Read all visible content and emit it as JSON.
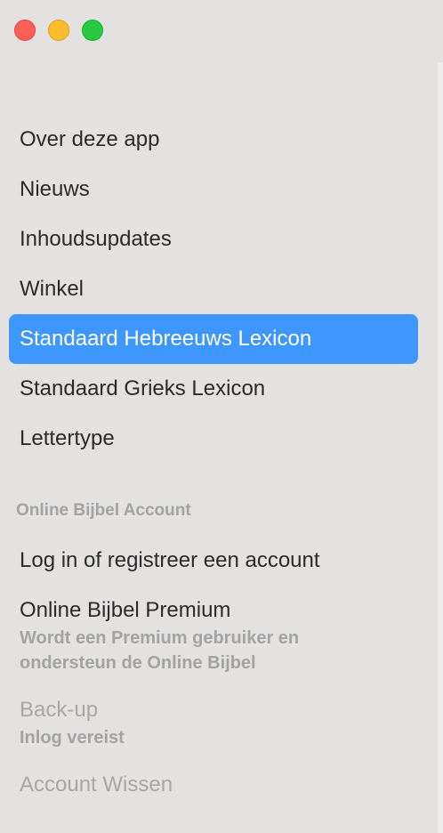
{
  "window": {
    "controls": [
      "close",
      "minimize",
      "maximize"
    ]
  },
  "menu": {
    "items": [
      {
        "label": "Over deze app"
      },
      {
        "label": "Nieuws"
      },
      {
        "label": "Inhoudsupdates"
      },
      {
        "label": "Winkel"
      },
      {
        "label": "Standaard Hebreeuws Lexicon",
        "selected": true
      },
      {
        "label": "Standaard Grieks Lexicon"
      },
      {
        "label": "Lettertype"
      }
    ]
  },
  "account": {
    "header": "Online Bijbel Account",
    "login_label": "Log in of registreer een account",
    "premium_label": "Online Bijbel Premium",
    "premium_sub_1": "Wordt een Premium gebruiker en",
    "premium_sub_2": "ondersteun de Online Bijbel",
    "backup_label": "Back-up",
    "backup_sub": "Inlog vereist",
    "delete_label": "Account Wissen"
  },
  "colors": {
    "selection": "#3d97fe",
    "sidebar_bg": "#e3e2e1"
  }
}
